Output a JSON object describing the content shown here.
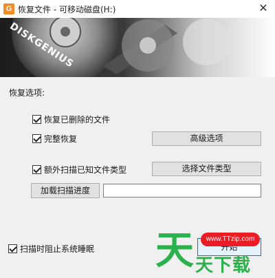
{
  "window": {
    "icon_letter": "G",
    "title": "恢复文件 - 可移动磁盘(H:)",
    "close_glyph": "✕"
  },
  "banner": {
    "brand": "DISKGENIUS"
  },
  "options": {
    "section_label": "恢复选项:",
    "recover_deleted": {
      "label": "恢复已删除的文件",
      "checked": true
    },
    "full_recover": {
      "label": "完整恢复",
      "checked": true
    },
    "advanced_button": "高级选项",
    "extra_scan": {
      "label": "额外扫描已知文件类型",
      "checked": true
    },
    "choose_types_button": "选择文件类型",
    "load_progress_button": "加载扫描进度",
    "progress_path_value": ""
  },
  "footer": {
    "prevent_sleep": {
      "label": "扫描时阻止系统睡眠",
      "checked": true
    },
    "start_button": "开始"
  },
  "watermark": {
    "url": "www.TTzip.com",
    "big_char": "天",
    "text": "天下载"
  },
  "colors": {
    "accent_border": "#0078d7",
    "watermark_green": "#2bb24c",
    "watermark_red": "#ea1c24"
  }
}
